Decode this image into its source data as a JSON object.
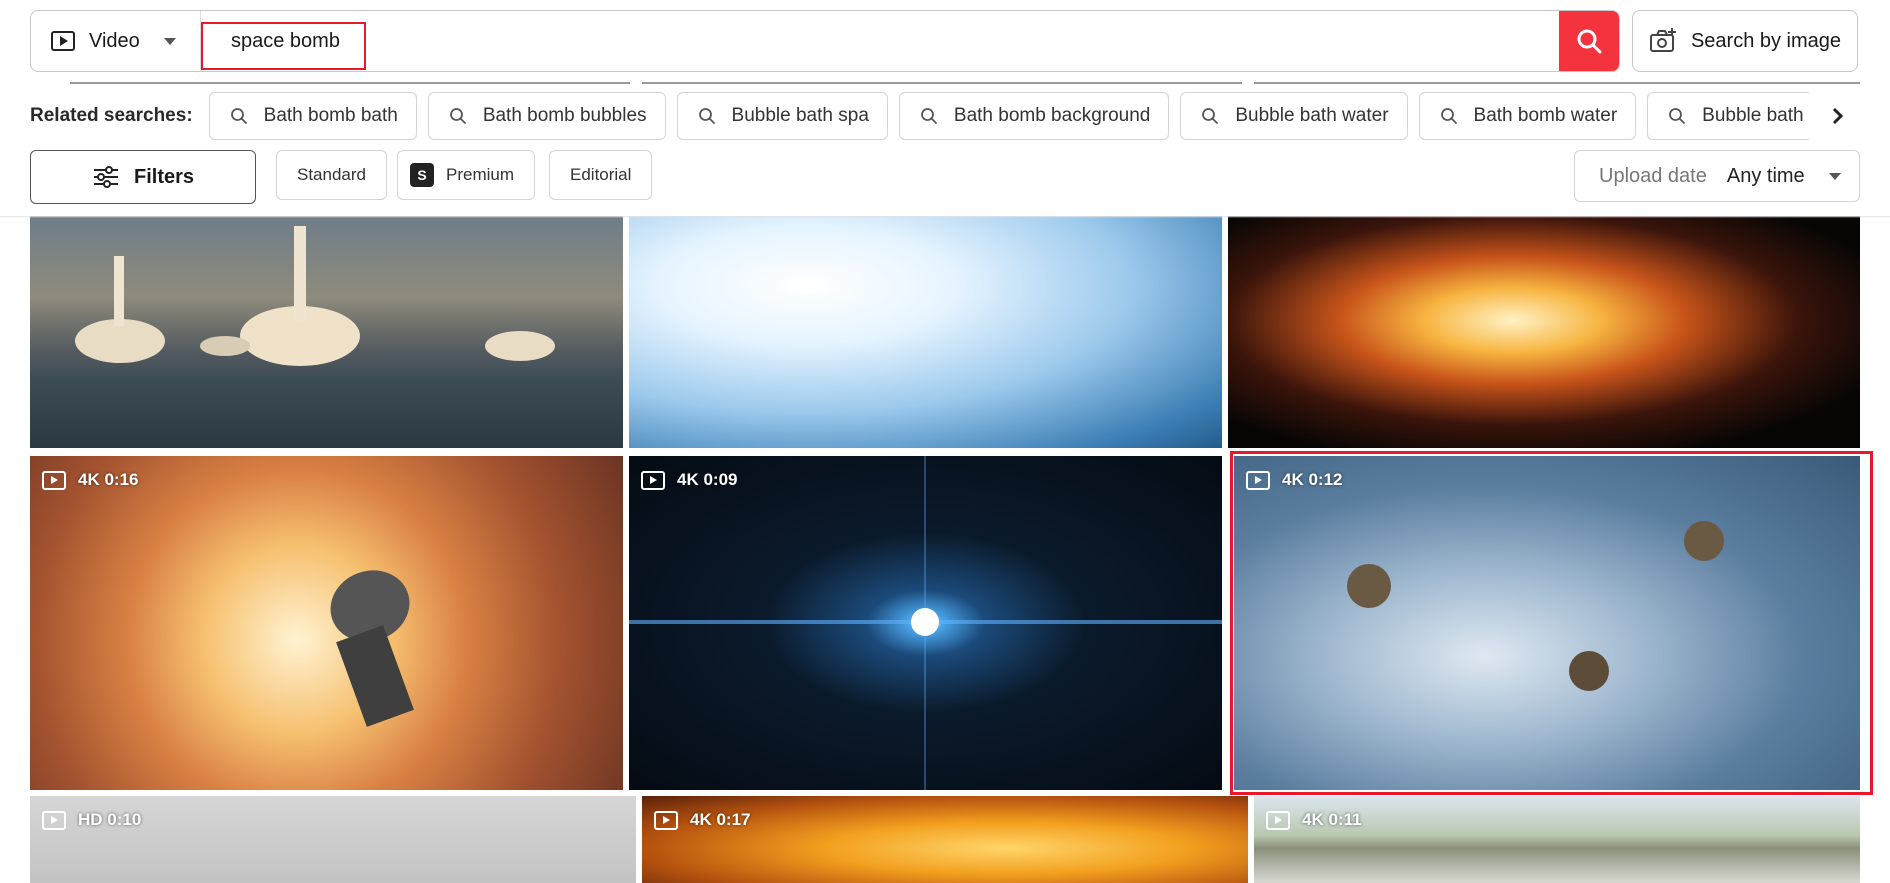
{
  "search": {
    "media_type": "Video",
    "query": "space bomb",
    "search_by_image_label": "Search by image"
  },
  "related": {
    "label": "Related searches:",
    "items": [
      "Bath bomb bath",
      "Bath bomb bubbles",
      "Bubble bath spa",
      "Bath bomb background",
      "Bubble bath water",
      "Bath bomb water",
      "Bubble bath bubble"
    ]
  },
  "filters": {
    "filters_label": "Filters",
    "license_options": [
      "Standard",
      "Premium",
      "Editorial"
    ],
    "premium_badge": "S",
    "upload_date_label": "Upload date",
    "upload_date_value": "Any time"
  },
  "results": [
    {
      "badge": ""
    },
    {
      "badge": ""
    },
    {
      "badge": ""
    },
    {
      "badge": "4K 0:16"
    },
    {
      "badge": "4K 0:09"
    },
    {
      "badge": "4K 0:12"
    },
    {
      "badge": "HD 0:10"
    },
    {
      "badge": "4K 0:17"
    },
    {
      "badge": "4K 0:11"
    }
  ],
  "colors": {
    "accent": "#f5333f",
    "highlight": "#e8192c"
  }
}
